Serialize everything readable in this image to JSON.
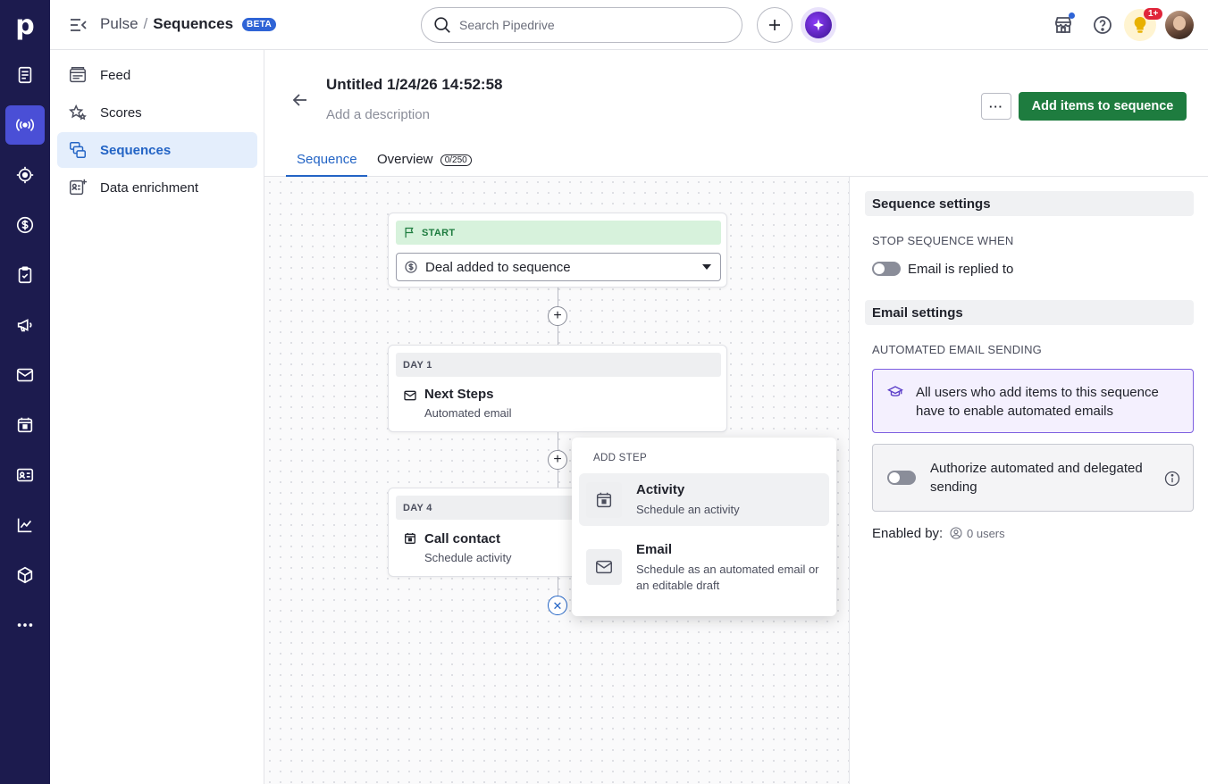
{
  "rail": {
    "logo": "p",
    "items": [
      {
        "icon": "document-list-icon",
        "active": false
      },
      {
        "icon": "broadcast-icon",
        "active": true
      },
      {
        "icon": "target-icon",
        "active": false
      },
      {
        "icon": "dollar-icon",
        "active": false
      },
      {
        "icon": "clipboard-check-icon",
        "active": false
      },
      {
        "icon": "megaphone-icon",
        "active": false
      },
      {
        "icon": "mail-icon",
        "active": false
      },
      {
        "icon": "calendar-icon",
        "active": false
      },
      {
        "icon": "contact-card-icon",
        "active": false
      },
      {
        "icon": "chart-line-icon",
        "active": false
      },
      {
        "icon": "box-icon",
        "active": false
      },
      {
        "icon": "more-horizontal-icon",
        "active": false
      }
    ]
  },
  "header": {
    "breadcrumb_parent": "Pulse",
    "breadcrumb_sep": "/",
    "breadcrumb_current": "Sequences",
    "beta_label": "BETA",
    "search_placeholder": "Search Pipedrive",
    "notification_count": "1+"
  },
  "subnav": {
    "items": [
      {
        "label": "Feed",
        "icon": "feed-icon",
        "active": false
      },
      {
        "label": "Scores",
        "icon": "stars-icon",
        "active": false
      },
      {
        "label": "Sequences",
        "icon": "sequences-icon",
        "active": true
      },
      {
        "label": "Data enrichment",
        "icon": "data-enrichment-icon",
        "active": false
      }
    ]
  },
  "sequence": {
    "title": "Untitled 1/24/26 14:52:58",
    "description_placeholder": "Add a description",
    "more_label": "···",
    "primary_action": "Add items to sequence",
    "tabs": [
      {
        "label": "Sequence",
        "active": true
      },
      {
        "label": "Overview",
        "count": "0/250",
        "active": false
      }
    ]
  },
  "canvas": {
    "start_label": "START",
    "trigger_value": "Deal added to sequence",
    "steps": [
      {
        "day": "DAY 1",
        "title": "Next Steps",
        "subtitle": "Automated email",
        "icon": "mail-icon"
      },
      {
        "day": "DAY 4",
        "title": "Call contact",
        "subtitle": "Schedule activity",
        "icon": "calendar-icon"
      }
    ]
  },
  "add_step_menu": {
    "heading": "ADD STEP",
    "options": [
      {
        "title": "Activity",
        "subtitle": "Schedule an activity",
        "icon": "calendar-icon"
      },
      {
        "title": "Email",
        "subtitle": "Schedule as an automated email or an editable draft",
        "icon": "mail-icon"
      }
    ]
  },
  "settings": {
    "sequence_settings_title": "Sequence settings",
    "stop_when_label": "STOP SEQUENCE WHEN",
    "email_replied_label": "Email is replied to",
    "email_settings_title": "Email settings",
    "automated_sending_label": "AUTOMATED EMAIL SENDING",
    "info_text": "All users who add items to this sequence have to enable automated emails",
    "authorize_label": "Authorize automated and delegated sending",
    "enabled_by_label": "Enabled by:",
    "enabled_users": "0 users"
  },
  "colors": {
    "rail_bg": "#1c1b4e",
    "rail_active": "#4a4fd6",
    "accent_blue": "#2364c5",
    "primary_green": "#1e7c3f",
    "start_band": "#d7f2dc"
  }
}
